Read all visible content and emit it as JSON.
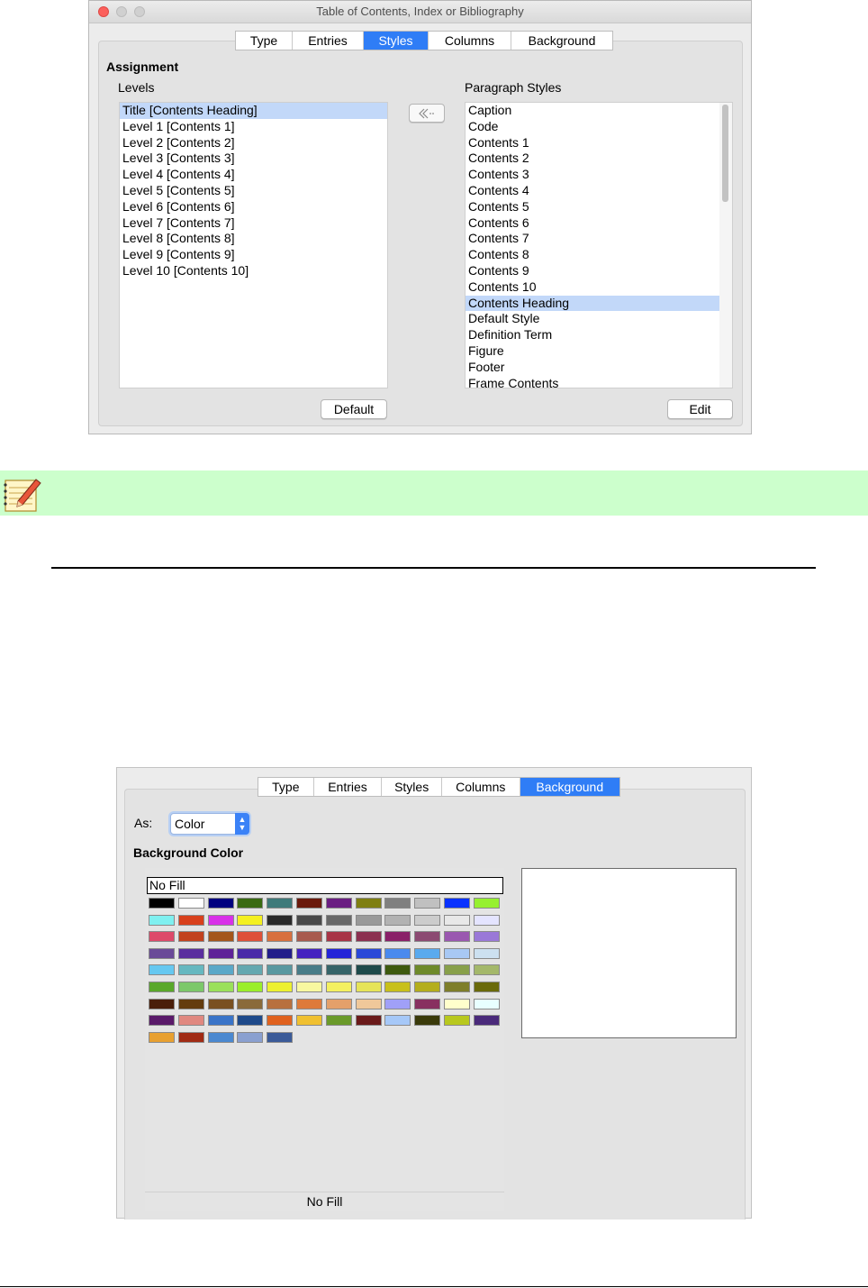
{
  "dialog1": {
    "title": "Table of Contents, Index or Bibliography",
    "tabs": [
      {
        "label": "Type",
        "active": false
      },
      {
        "label": "Entries",
        "active": false
      },
      {
        "label": "Styles",
        "active": true
      },
      {
        "label": "Columns",
        "active": false
      },
      {
        "label": "Background",
        "active": false
      }
    ],
    "assignment_heading": "Assignment",
    "levels_label": "Levels",
    "paragraph_styles_label": "Paragraph Styles",
    "levels": [
      "Title [Contents Heading]",
      "Level 1 [Contents 1]",
      "Level 2 [Contents 2]",
      "Level 3 [Contents 3]",
      "Level 4 [Contents 4]",
      "Level 5 [Contents 5]",
      "Level 6 [Contents 6]",
      "Level 7 [Contents 7]",
      "Level 8 [Contents 8]",
      "Level 9 [Contents 9]",
      "Level 10 [Contents 10]"
    ],
    "levels_selected_index": 0,
    "paragraph_styles": [
      "Caption",
      "Code",
      "Contents 1",
      "Contents 2",
      "Contents 3",
      "Contents 4",
      "Contents 5",
      "Contents 6",
      "Contents 7",
      "Contents 8",
      "Contents 9",
      "Contents 10",
      "Contents Heading",
      "Default Style",
      "Definition Term",
      "Figure",
      "Footer",
      "Frame Contents"
    ],
    "paragraph_selected_index": 12,
    "assign_icon": "double-chevron-left-icon",
    "default_button": "Default",
    "edit_button": "Edit"
  },
  "note": {
    "icon": "notepad-pencil-icon",
    "background": "#ccffcc"
  },
  "dialog2": {
    "tabs": [
      {
        "label": "Type",
        "active": false
      },
      {
        "label": "Entries",
        "active": false
      },
      {
        "label": "Styles",
        "active": false
      },
      {
        "label": "Columns",
        "active": false
      },
      {
        "label": "Background",
        "active": true
      }
    ],
    "as_label": "As:",
    "as_value": "Color",
    "background_color_heading": "Background Color",
    "no_fill_label": "No Fill",
    "status_text": "No Fill",
    "palette": [
      "#000000",
      "#ffffff",
      "#000080",
      "#3a6a12",
      "#3f7a7a",
      "#6b1a0c",
      "#6a1e82",
      "#7f7f12",
      "#808080",
      "#c0c0c0",
      "#0a32ff",
      "#96f030",
      "#7ff0f0",
      "#d8401c",
      "#d830e8",
      "#f4f020",
      "#2a2a2a",
      "#4a4a4a",
      "#686868",
      "#999999",
      "#b2b2b2",
      "#cccccc",
      "#e8e8e8",
      "#e4e4ff",
      "#dd4a6a",
      "#c2421e",
      "#a4561a",
      "#de5038",
      "#d8703e",
      "#a85a4e",
      "#a83446",
      "#8c3050",
      "#8a2068",
      "#8c4a72",
      "#9a58b0",
      "#9a78d8",
      "#6a4a98",
      "#5a2e9e",
      "#5e2298",
      "#4a2aa8",
      "#221e8a",
      "#4422c0",
      "#2424d8",
      "#2a48d8",
      "#4a8aee",
      "#5aaaee",
      "#a8c8f4",
      "#cce0f0",
      "#66c8f0",
      "#66b8c0",
      "#5aa8c8",
      "#64a8b0",
      "#5898a0",
      "#487c88",
      "#366468",
      "#1e4a4a",
      "#3e5a0e",
      "#6e8a2a",
      "#88a04a",
      "#a4b86a",
      "#5aa82a",
      "#7cc86a",
      "#9ae05a",
      "#9aee2a",
      "#ecf030",
      "#f8f8a0",
      "#f4f060",
      "#e6e458",
      "#c8c01a",
      "#b4ae1c",
      "#7e7e2a",
      "#6a6a0a",
      "#4a1e0a",
      "#643c0e",
      "#7a5020",
      "#8a6a3a",
      "#b8703e",
      "#de7a3a",
      "#e4a06a",
      "#f0c89a",
      "#a0a0f8",
      "#883060",
      "#ffffcc",
      "#e8ffff",
      "#5a1a6a",
      "#e08880",
      "#3a74c8",
      "#1e4a8a",
      "#e0621e",
      "#f0c030",
      "#6a9a2a",
      "#6a1a1a",
      "#a6c8f8",
      "#3a3a0a",
      "#b8c81e",
      "#4a2a7a",
      "#e8a030",
      "#a02a14",
      "#4a88d0",
      "#8aa0d0",
      "#3a5a98"
    ]
  }
}
